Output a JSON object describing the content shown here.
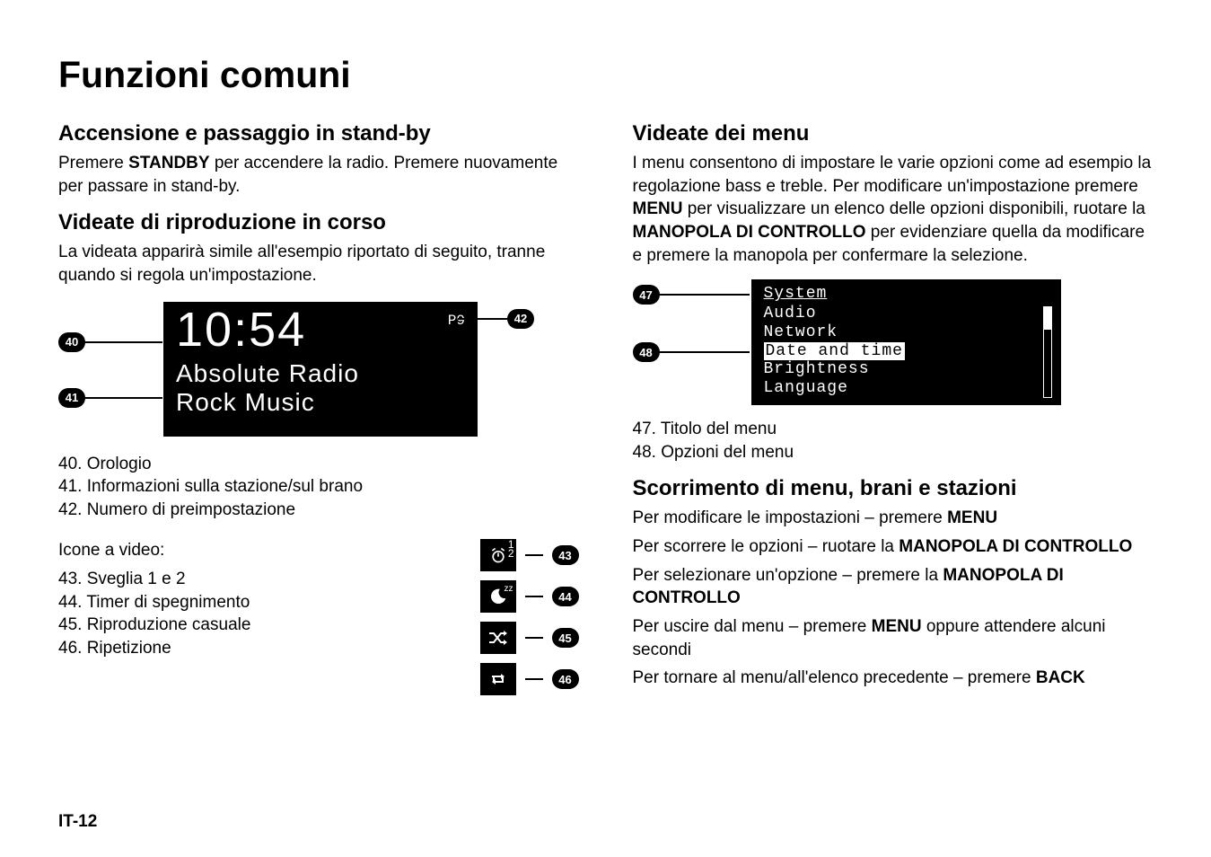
{
  "title": "Funzioni comuni",
  "left": {
    "h_standby": "Accensione e passaggio in stand-by",
    "p_standby_a": "Premere ",
    "p_standby_b": "STANDBY",
    "p_standby_c": " per accendere la radio. Premere nuovamente per passare in stand-by.",
    "h_play": "Videate di riproduzione in corso",
    "p_play": "La videata apparirà simile all'esempio riportato di seguito, tranne quando si regola un'impostazione.",
    "lcd": {
      "time": "10:54",
      "preset": "P9",
      "line2": "Absolute Radio",
      "line3": "Rock Music"
    },
    "call40": "40",
    "call41": "41",
    "call42": "42",
    "list40_0": "40.  Orologio",
    "list40_1": "41.  Informazioni sulla stazione/sul brano",
    "list40_2": "42.  Numero di preimpostazione",
    "icons_intro": "Icone a video:",
    "list43_0": "43.  Sveglia 1 e 2",
    "list43_1": "44.  Timer di spegnimento",
    "list43_2": "45.  Riproduzione casuale",
    "list43_3": "46.  Ripetizione",
    "call43": "43",
    "call44": "44",
    "call45": "45",
    "call46": "46",
    "icon43_sup": "1\n2"
  },
  "right": {
    "h_menu": "Videate dei menu",
    "p_menu_a": "I menu consentono di impostare le varie opzioni come ad esempio la regolazione bass e treble. Per modificare un'impostazione premere ",
    "p_menu_b": "MENU",
    "p_menu_c": " per visualizzare un elenco delle opzioni disponibili, ruotare la ",
    "p_menu_d": "MANOPOLA DI CONTROLLO",
    "p_menu_e": " per evidenziare quella da modificare e premere la manopola per confermare la selezione.",
    "lcd2": {
      "title": "System",
      "o1": "Audio",
      "o2": "Network",
      "o3": "Date and time",
      "o4": "Brightness",
      "o5": "Language"
    },
    "call47": "47",
    "call48": "48",
    "list47_0": "47.  Titolo del menu",
    "list47_1": "48.  Opzioni del menu",
    "h_scroll": "Scorrimento di menu, brani e stazioni",
    "scroll_lines": [
      [
        "Per modificare le impostazioni – premere ",
        "MENU",
        ""
      ],
      [
        "Per scorrere le opzioni – ruotare la ",
        "MANOPOLA DI CONTROLLO",
        ""
      ],
      [
        "Per selezionare un'opzione – premere la ",
        "MANOPOLA DI CONTROLLO",
        ""
      ],
      [
        "Per uscire dal menu – premere ",
        "MENU",
        " oppure attendere alcuni secondi"
      ],
      [
        "Per tornare al menu/all'elenco precedente – premere ",
        "BACK",
        ""
      ]
    ]
  },
  "footer": "IT-12"
}
